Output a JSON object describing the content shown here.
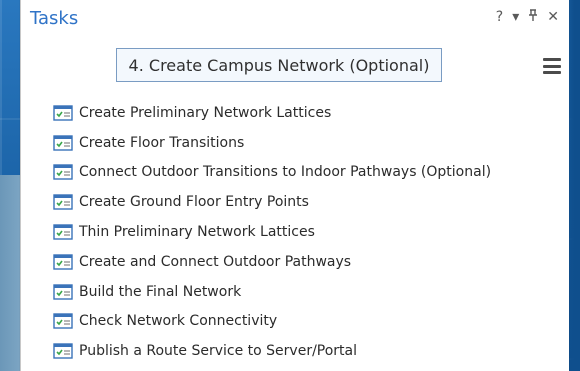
{
  "pane": {
    "title": "Tasks",
    "controls": {
      "help": "?",
      "menu": "▾",
      "pin": "⊥",
      "close": "✕"
    }
  },
  "step": {
    "label": "4. Create Campus Network (Optional)"
  },
  "tasks": [
    {
      "label": "Create Preliminary Network Lattices",
      "icon": "task-checklist-icon"
    },
    {
      "label": "Create Floor Transitions",
      "icon": "task-checklist-icon"
    },
    {
      "label": "Connect Outdoor Transitions to Indoor Pathways (Optional)",
      "icon": "task-checklist-icon"
    },
    {
      "label": "Create Ground Floor Entry Points",
      "icon": "task-checklist-icon"
    },
    {
      "label": "Thin Preliminary Network Lattices",
      "icon": "task-checklist-icon"
    },
    {
      "label": "Create and Connect Outdoor Pathways",
      "icon": "task-checklist-icon"
    },
    {
      "label": "Build the Final Network",
      "icon": "task-checklist-icon"
    },
    {
      "label": "Check Network Connectivity",
      "icon": "task-checklist-icon"
    },
    {
      "label": "Publish a Route Service to Server/Portal",
      "icon": "task-checklist-icon"
    }
  ],
  "colors": {
    "title": "#2f73c7",
    "step_border": "#7a9cc3",
    "icon_blue": "#3a73b9",
    "icon_check": "#3aa64a"
  }
}
